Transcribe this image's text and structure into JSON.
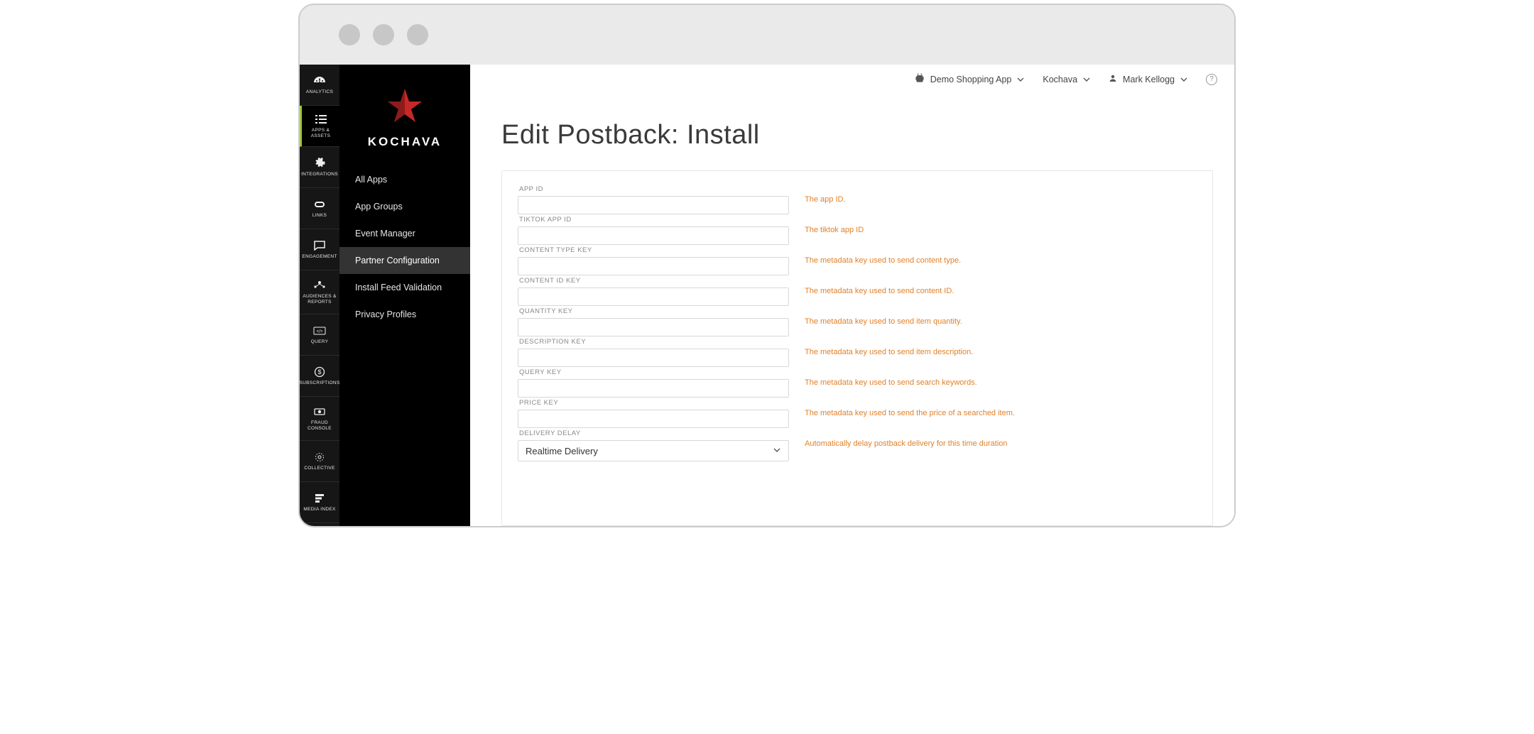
{
  "brand": {
    "name": "KOCHAVA"
  },
  "rail": {
    "items": [
      {
        "label": "ANALYTICS"
      },
      {
        "label": "APPS &\nASSETS"
      },
      {
        "label": "INTEGRATIONS"
      },
      {
        "label": "LINKS"
      },
      {
        "label": "ENGAGEMENT"
      },
      {
        "label": "AUDIENCES &\nREPORTS"
      },
      {
        "label": "QUERY"
      },
      {
        "label": "SUBSCRIPTIONS"
      },
      {
        "label": "FRAUD\nCONSOLE"
      },
      {
        "label": "COLLECTIVE"
      },
      {
        "label": "MEDIA INDEX"
      }
    ]
  },
  "subnav": {
    "items": [
      {
        "label": "All Apps"
      },
      {
        "label": "App Groups"
      },
      {
        "label": "Event Manager"
      },
      {
        "label": "Partner Configuration"
      },
      {
        "label": "Install Feed Validation"
      },
      {
        "label": "Privacy Profiles"
      }
    ]
  },
  "topbar": {
    "app_selector": "Demo Shopping App",
    "org_selector": "Kochava",
    "user": "Mark Kellogg"
  },
  "page": {
    "title": "Edit Postback: Install"
  },
  "form": {
    "fields": [
      {
        "label": "APP ID",
        "help": "The app ID.",
        "value": ""
      },
      {
        "label": "TIKTOK APP ID",
        "help": "The tiktok app ID",
        "value": ""
      },
      {
        "label": "CONTENT TYPE KEY",
        "help": "The metadata key used to send content type.",
        "value": ""
      },
      {
        "label": "CONTENT ID KEY",
        "help": "The metadata key used to send content ID.",
        "value": ""
      },
      {
        "label": "QUANTITY KEY",
        "help": "The metadata key used to send item quantity.",
        "value": ""
      },
      {
        "label": "DESCRIPTION KEY",
        "help": "The metadata key used to send item description.",
        "value": ""
      },
      {
        "label": "QUERY KEY",
        "help": "The metadata key used to send search keywords.",
        "value": ""
      },
      {
        "label": "PRICE KEY",
        "help": "The metadata key used to send the price of a searched item.",
        "value": ""
      }
    ],
    "delivery_delay": {
      "label": "DELIVERY DELAY",
      "selected": "Realtime Delivery",
      "help": "Automatically delay postback delivery for this time duration"
    }
  }
}
